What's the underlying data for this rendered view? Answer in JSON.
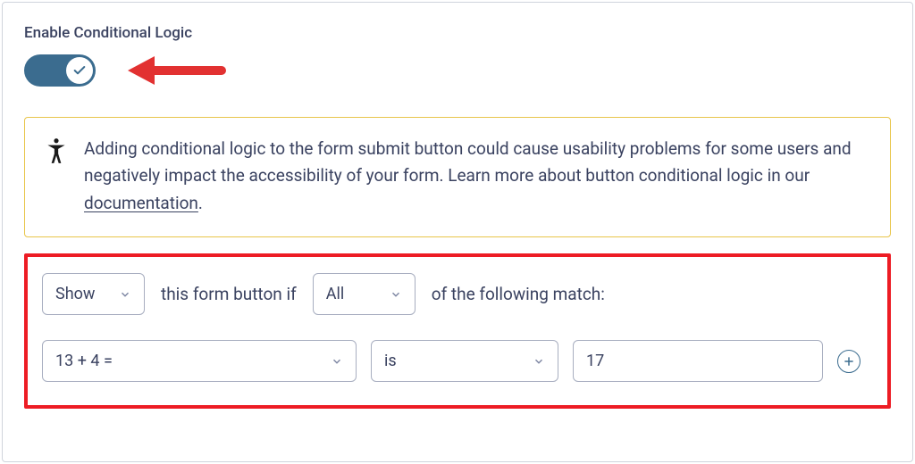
{
  "header": {
    "label": "Enable Conditional Logic"
  },
  "toggle": {
    "on": true
  },
  "notice": {
    "text_before": "Adding conditional logic to the form submit button could cause usability problems for some users and negatively impact the accessibility of your form. Learn more about button conditional logic in our ",
    "link_text": "documentation",
    "text_after": "."
  },
  "rules": {
    "action": "Show",
    "mid1": "this form button if",
    "match": "All",
    "mid2": "of the following match:",
    "row": {
      "field": "13 + 4 =",
      "operator": "is",
      "value": "17"
    }
  }
}
